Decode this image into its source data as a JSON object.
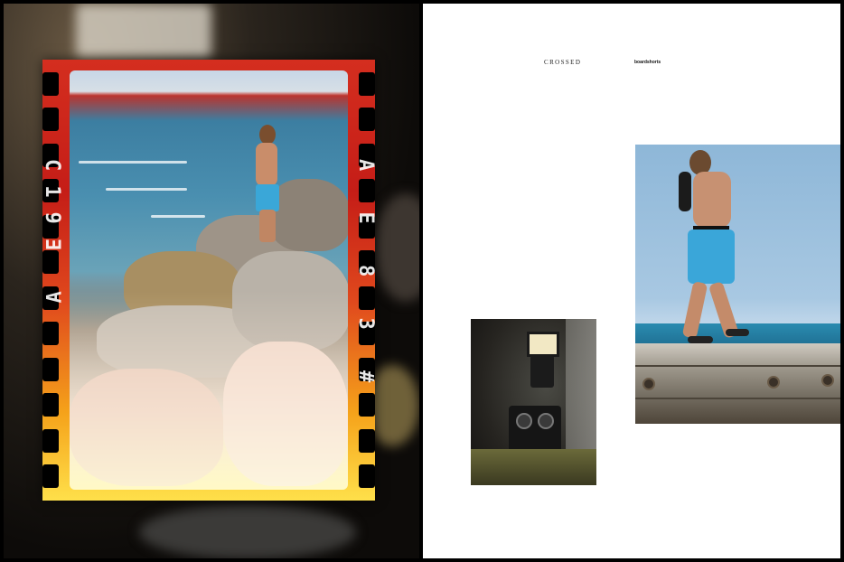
{
  "header": {
    "brand": "CROSSED",
    "section": "boardshorts"
  },
  "film": {
    "left_mark": "C19Ǝ Ɐ",
    "right_mark": "A E 8 3 #"
  },
  "colors": {
    "page_background": "#000000",
    "right_page": "#ffffff",
    "shorts_blue": "#3aa6d9"
  }
}
